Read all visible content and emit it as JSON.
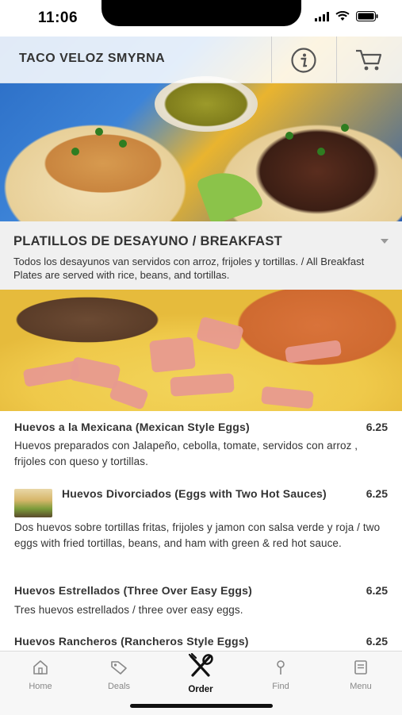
{
  "status_bar": {
    "time": "11:06"
  },
  "header": {
    "title": "TACO VELOZ SMYRNA"
  },
  "section": {
    "title": "PLATILLOS DE DESAYUNO / BREAKFAST",
    "description": "Todos los desayunos van servidos con arroz, frijoles y tortillas. / All Breakfast Plates are served with rice, beans, and tortillas."
  },
  "items": [
    {
      "name": "Huevos a la Mexicana (Mexican Style Eggs)",
      "price": "6.25",
      "description": "Huevos preparados con Jalapeño, cebolla, tomate, servidos con arroz , frijoles con queso y tortillas."
    },
    {
      "name": "Huevos Divorciados (Eggs with Two Hot Sauces)",
      "price": "6.25",
      "description": "Dos huevos sobre tortillas fritas, frijoles y jamon con salsa verde y roja / two eggs with fried tortillas, beans, and ham with green & red hot sauce."
    },
    {
      "name": "Huevos Estrellados (Three Over Easy Eggs)",
      "price": "6.25",
      "description": "Tres huevos estrellados / three over easy eggs."
    },
    {
      "name": "Huevos Rancheros (Rancheros Style Eggs)",
      "price": "6.25"
    }
  ],
  "tabs": [
    {
      "label": "Home",
      "icon": "home-icon"
    },
    {
      "label": "Deals",
      "icon": "tag-icon"
    },
    {
      "label": "Order",
      "icon": "utensils-icon",
      "active": true
    },
    {
      "label": "Find",
      "icon": "pin-icon"
    },
    {
      "label": "Menu",
      "icon": "menu-book-icon"
    }
  ]
}
